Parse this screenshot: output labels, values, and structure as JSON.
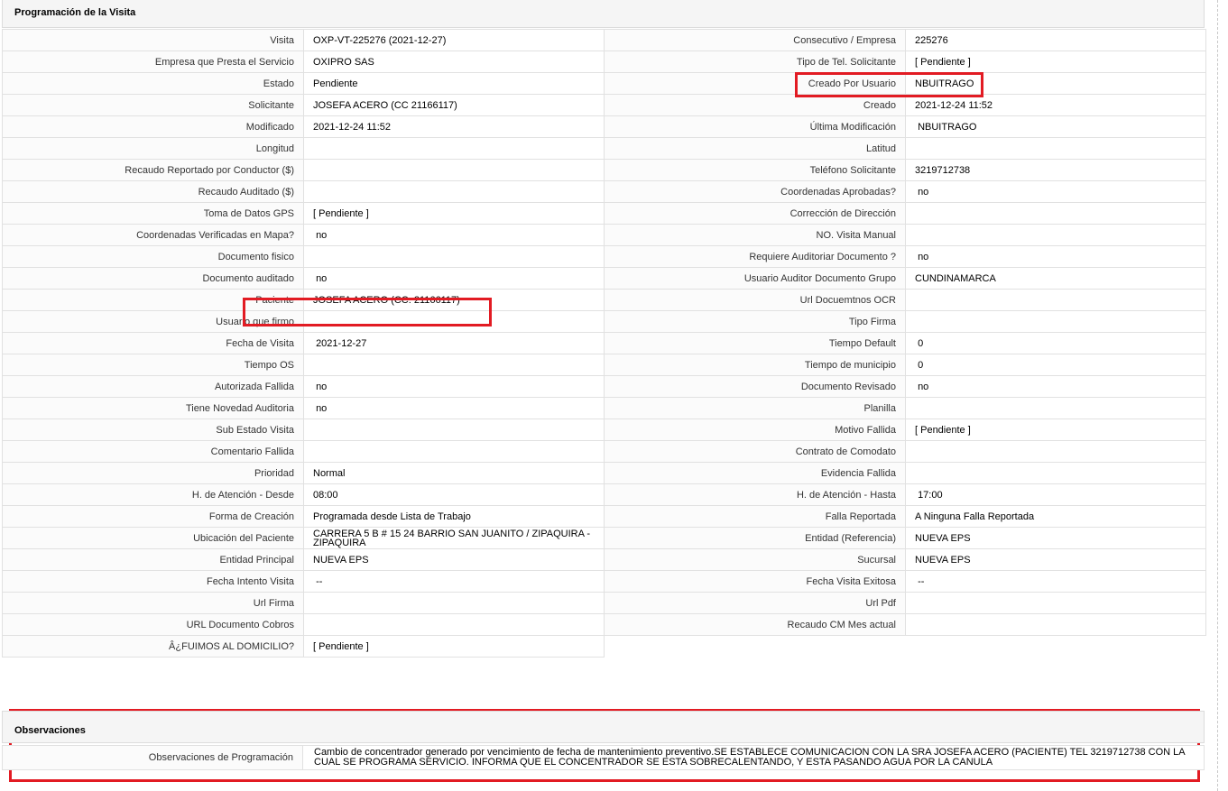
{
  "section": {
    "title": "Programación de la Visita"
  },
  "rows": [
    {
      "l1": "Visita",
      "v1": "OXP-VT-225276 (2021-12-27)",
      "l2": "Consecutivo / Empresa",
      "v2": "225276"
    },
    {
      "l1": "Empresa que Presta el Servicio",
      "v1": "OXIPRO SAS",
      "l2": "Tipo de Tel. Solicitante",
      "v2": "[ Pendiente ]"
    },
    {
      "l1": "Estado",
      "v1": "Pendiente",
      "l2": "Creado Por Usuario",
      "v2": "NBUITRAGO"
    },
    {
      "l1": "Solicitante",
      "v1": "JOSEFA ACERO (CC 21166117)",
      "l2": "Creado",
      "v2": "2021-12-24 11:52"
    },
    {
      "l1": "Modificado",
      "v1": "2021-12-24 11:52",
      "l2": "Última Modificación",
      "v2": " NBUITRAGO"
    },
    {
      "l1": "Longitud",
      "v1": "",
      "l2": "Latitud",
      "v2": ""
    },
    {
      "l1": "Recaudo Reportado por Conductor ($)",
      "v1": "",
      "l2": "Teléfono Solicitante",
      "v2": "3219712738"
    },
    {
      "l1": "Recaudo Auditado ($)",
      "v1": "",
      "l2": "Coordenadas Aprobadas?",
      "v2": " no"
    },
    {
      "l1": "Toma de Datos GPS",
      "v1": "[ Pendiente ]",
      "l2": "Corrección de Dirección",
      "v2": ""
    },
    {
      "l1": "Coordenadas Verificadas en Mapa?",
      "v1": " no",
      "l2": "NO. Visita Manual",
      "v2": ""
    },
    {
      "l1": "Documento fisico",
      "v1": "",
      "l2": "Requiere Auditoriar Documento ?",
      "v2": " no"
    },
    {
      "l1": "Documento auditado",
      "v1": " no",
      "l2": "Usuario Auditor Documento Grupo",
      "v2": "CUNDINAMARCA"
    },
    {
      "l1": "Paciente",
      "v1": "JOSEFA ACERO (CC: 21166117)",
      "l2": "Url Docuemtnos OCR",
      "v2": ""
    },
    {
      "l1": "Usuario que firmo",
      "v1": "",
      "l2": "Tipo Firma",
      "v2": ""
    },
    {
      "l1": "Fecha de Visita",
      "v1": " 2021-12-27",
      "l2": "Tiempo Default",
      "v2": " 0"
    },
    {
      "l1": "Tiempo OS",
      "v1": "",
      "l2": "Tiempo de municipio",
      "v2": " 0"
    },
    {
      "l1": "Autorizada Fallida",
      "v1": " no",
      "l2": "Documento Revisado",
      "v2": " no"
    },
    {
      "l1": "Tiene Novedad Auditoria",
      "v1": " no",
      "l2": "Planilla",
      "v2": ""
    },
    {
      "l1": "Sub Estado Visita",
      "v1": "",
      "l2": "Motivo Fallida",
      "v2": "[ Pendiente ]"
    },
    {
      "l1": "Comentario Fallida",
      "v1": "",
      "l2": "Contrato de Comodato",
      "v2": ""
    },
    {
      "l1": "Prioridad",
      "v1": "Normal",
      "l2": "Evidencia Fallida",
      "v2": ""
    },
    {
      "l1": "H. de Atención - Desde",
      "v1": "08:00",
      "l2": "H. de Atención - Hasta",
      "v2": " 17:00"
    },
    {
      "l1": "Forma de Creación",
      "v1": "Programada desde Lista de Trabajo",
      "l2": "Falla Reportada",
      "v2": "A Ninguna Falla Reportada"
    },
    {
      "l1": "Ubicación del Paciente",
      "v1": "CARRERA 5 B # 15 24 BARRIO SAN JUANITO / ZIPAQUIRA - ZIPAQUIRA",
      "l2": "Entidad (Referencia)",
      "v2": "NUEVA EPS"
    },
    {
      "l1": "Entidad Principal",
      "v1": "NUEVA EPS",
      "l2": "Sucursal",
      "v2": "NUEVA EPS"
    },
    {
      "l1": "Fecha Intento Visita",
      "v1": " --",
      "l2": "Fecha Visita Exitosa",
      "v2": " --"
    },
    {
      "l1": "Url Firma",
      "v1": "",
      "l2": "Url Pdf",
      "v2": ""
    },
    {
      "l1": "URL Documento Cobros",
      "v1": "",
      "l2": "Recaudo CM Mes actual",
      "v2": ""
    },
    {
      "l1": "Â¿FUIMOS AL DOMICILIO?",
      "v1": "[ Pendiente ]"
    }
  ],
  "observaciones": {
    "title": "Observaciones",
    "label": "Observaciones de Programación",
    "text": "Cambio de concentrador generado por vencimiento de fecha de mantenimiento preventivo.SE ESTABLECE COMUNICACION CON LA SRA JOSEFA ACERO (PACIENTE) TEL 3219712738 CON LA CUAL SE PROGRAMA SERVICIO. INFORMA QUE EL CONCENTRADOR SE ESTA SOBRECALENTANDO, Y ESTA PASANDO AGUA POR LA CANULA"
  },
  "colors": {
    "highlight": "#e21b23",
    "border": "#e1e1e1",
    "header_bg": "#f5f5f5"
  }
}
